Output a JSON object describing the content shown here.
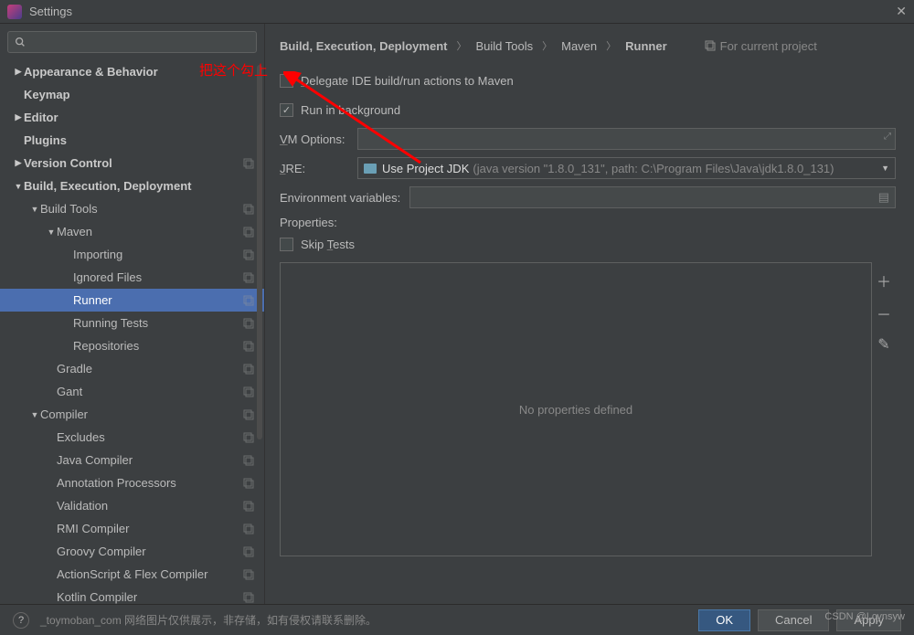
{
  "window": {
    "title": "Settings"
  },
  "breadcrumb": {
    "items": [
      "Build, Execution, Deployment",
      "Build Tools",
      "Maven",
      "Runner"
    ],
    "projectScope": "For current project"
  },
  "sidebar": {
    "items": [
      {
        "label": "Appearance & Behavior",
        "level": 0,
        "arrow": "▶",
        "badge": false
      },
      {
        "label": "Keymap",
        "level": 0,
        "arrow": "",
        "badge": false
      },
      {
        "label": "Editor",
        "level": 0,
        "arrow": "▶",
        "badge": false
      },
      {
        "label": "Plugins",
        "level": 0,
        "arrow": "",
        "badge": false
      },
      {
        "label": "Version Control",
        "level": 0,
        "arrow": "▶",
        "badge": true
      },
      {
        "label": "Build, Execution, Deployment",
        "level": 0,
        "arrow": "▼",
        "badge": false
      },
      {
        "label": "Build Tools",
        "level": 1,
        "arrow": "▼",
        "badge": true
      },
      {
        "label": "Maven",
        "level": 2,
        "arrow": "▼",
        "badge": true
      },
      {
        "label": "Importing",
        "level": 3,
        "arrow": "",
        "badge": true
      },
      {
        "label": "Ignored Files",
        "level": 3,
        "arrow": "",
        "badge": true
      },
      {
        "label": "Runner",
        "level": 3,
        "arrow": "",
        "badge": true,
        "selected": true
      },
      {
        "label": "Running Tests",
        "level": 3,
        "arrow": "",
        "badge": true
      },
      {
        "label": "Repositories",
        "level": 3,
        "arrow": "",
        "badge": true
      },
      {
        "label": "Gradle",
        "level": 2,
        "arrow": "",
        "badge": true
      },
      {
        "label": "Gant",
        "level": 2,
        "arrow": "",
        "badge": true
      },
      {
        "label": "Compiler",
        "level": 1,
        "arrow": "▼",
        "badge": true
      },
      {
        "label": "Excludes",
        "level": 2,
        "arrow": "",
        "badge": true
      },
      {
        "label": "Java Compiler",
        "level": 2,
        "arrow": "",
        "badge": true
      },
      {
        "label": "Annotation Processors",
        "level": 2,
        "arrow": "",
        "badge": true
      },
      {
        "label": "Validation",
        "level": 2,
        "arrow": "",
        "badge": true
      },
      {
        "label": "RMI Compiler",
        "level": 2,
        "arrow": "",
        "badge": true
      },
      {
        "label": "Groovy Compiler",
        "level": 2,
        "arrow": "",
        "badge": true
      },
      {
        "label": "ActionScript & Flex Compiler",
        "level": 2,
        "arrow": "",
        "badge": true
      },
      {
        "label": "Kotlin Compiler",
        "level": 2,
        "arrow": "",
        "badge": true
      }
    ]
  },
  "form": {
    "delegate": {
      "label": "Delegate IDE build/run actions to Maven",
      "checked": false
    },
    "background": {
      "label": "Run in background",
      "checked": true
    },
    "vmOptions": {
      "label": "VM Options:",
      "value": ""
    },
    "jre": {
      "label": "JRE:",
      "main": "Use Project JDK",
      "detail": "(java version \"1.8.0_131\", path: C:\\Program Files\\Java\\jdk1.8.0_131)"
    },
    "env": {
      "label": "Environment variables:",
      "value": ""
    },
    "propsLabel": "Properties:",
    "skip": {
      "label": "Skip Tests",
      "checked": false
    },
    "noProps": "No properties defined"
  },
  "buttons": {
    "ok": "OK",
    "cancel": "Cancel",
    "apply": "Apply"
  },
  "annotation": "把这个勾上",
  "footerText": "_toymoban_com 网络图片仅供展示，非存储，如有侵权请联系删除。",
  "watermark": "CSDN @Lcynsyw"
}
